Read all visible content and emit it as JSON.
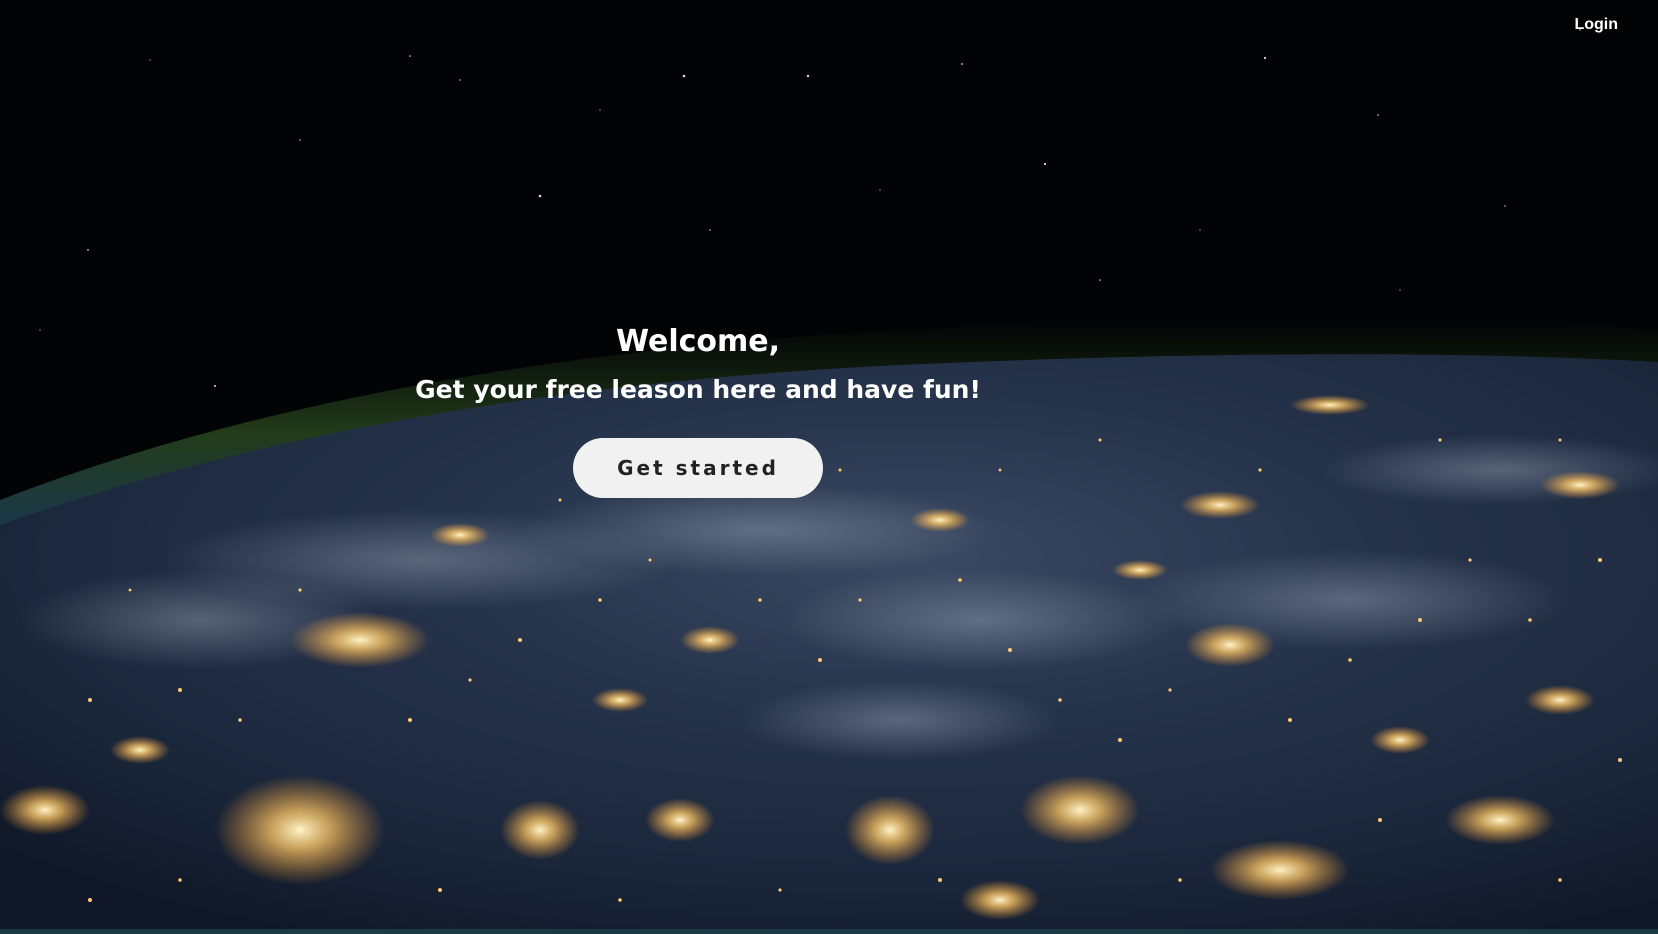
{
  "nav": {
    "login_label": "Login"
  },
  "hero": {
    "heading": "Welcome,",
    "subheading": "Get your free leason here and have fun!",
    "cta_label": "Get started"
  },
  "colors": {
    "space": "#020305",
    "ocean": "#1d2c44",
    "city_lights": "#ffd27a",
    "atmosphere": "#3f6a28",
    "button_bg": "#f1f1f1",
    "button_text": "#222222",
    "text": "#ffffff"
  }
}
